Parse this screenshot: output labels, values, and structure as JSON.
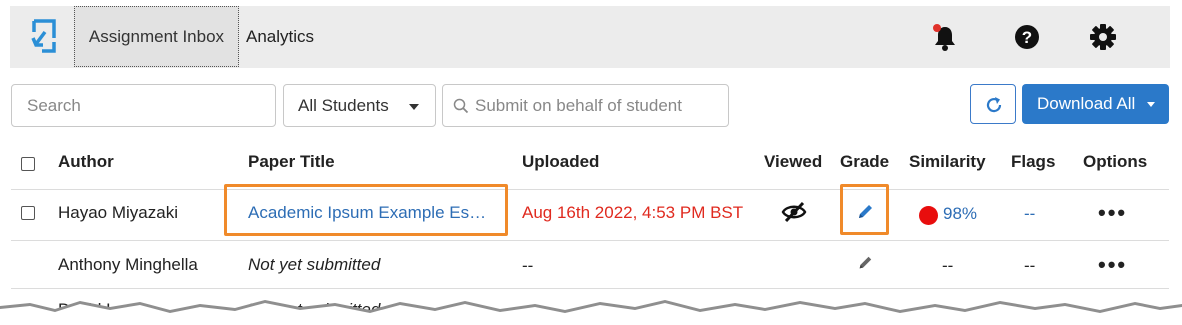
{
  "nav": {
    "tab_inbox": "Assignment Inbox",
    "tab_analytics": "Analytics",
    "icons": [
      "logo-icon",
      "bell-icon",
      "help-icon",
      "gear-icon"
    ],
    "notification_color": "#e0312a"
  },
  "toolbar": {
    "search_placeholder": "Search",
    "student_filter": "All Students",
    "behalf_placeholder": "Submit on behalf of student",
    "download_label": "Download All",
    "accent": "#2b79c9"
  },
  "table": {
    "headers": {
      "author": "Author",
      "paper_title": "Paper Title",
      "uploaded": "Uploaded",
      "viewed": "Viewed",
      "grade": "Grade",
      "similarity": "Similarity",
      "flags": "Flags",
      "options": "Options"
    },
    "rows": [
      {
        "author": "Hayao Miyazaki",
        "title": "Academic Ipsum Example Es…",
        "uploaded": "Aug 16th 2022, 4:53 PM BST",
        "similarity": "98%",
        "flags": "--",
        "options": "•••"
      },
      {
        "author": "Anthony Minghella",
        "title": "Not yet submitted",
        "uploaded": "--",
        "similarity": "--",
        "flags": "--",
        "options": "•••"
      },
      {
        "author": "David Lean",
        "title": "Not yet submitted"
      }
    ]
  },
  "colors": {
    "highlight": "#f08a2a",
    "late_text": "#e02a1f",
    "similarity_high": "#e80d0d",
    "link": "#2d6db5"
  }
}
